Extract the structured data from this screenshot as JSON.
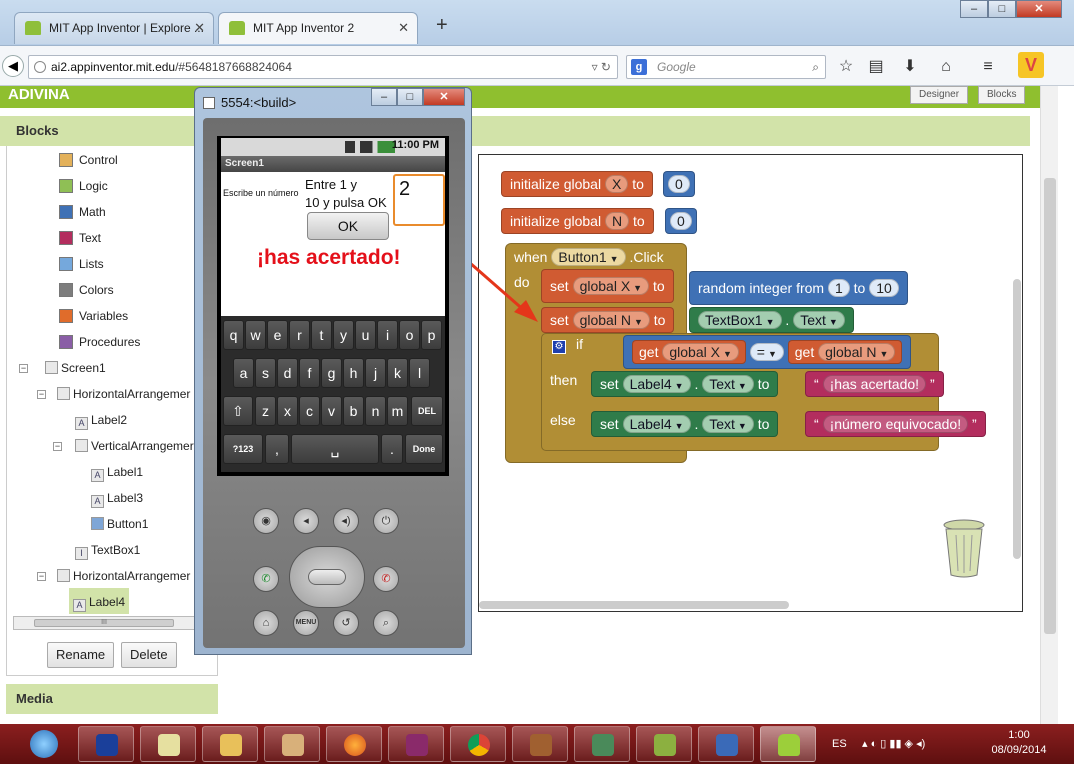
{
  "browser": {
    "tabs": [
      {
        "label": "MIT App Inventor | Explore ..."
      },
      {
        "label": "MIT App Inventor 2"
      }
    ],
    "new_tab": "+",
    "url_domain": "ai2.appinventor.mit.edu",
    "url_path": "/#5648187668824064",
    "search_placeholder": "Google",
    "window_controls": {
      "minimize": "–",
      "maximize": "□",
      "close": "✕"
    }
  },
  "app": {
    "project_name": "ADIVINA",
    "designer_button": "Designer",
    "blocks_button": "Blocks"
  },
  "sidebar": {
    "header": "Blocks",
    "builtin": [
      {
        "label": "Control",
        "color": "#e3b15a"
      },
      {
        "label": "Logic",
        "color": "#8fbf55"
      },
      {
        "label": "Math",
        "color": "#3f71b5"
      },
      {
        "label": "Text",
        "color": "#b32d5e"
      },
      {
        "label": "Lists",
        "color": "#75a8dc"
      },
      {
        "label": "Colors",
        "color": "#7d7d7d"
      },
      {
        "label": "Variables",
        "color": "#e06c2b"
      },
      {
        "label": "Procedures",
        "color": "#8a5ea6"
      }
    ],
    "tree": [
      {
        "label": "Screen1"
      },
      {
        "label": "HorizontalArrangemer"
      },
      {
        "label": "Label2"
      },
      {
        "label": "VerticalArrangemer"
      },
      {
        "label": "Label1"
      },
      {
        "label": "Label3"
      },
      {
        "label": "Button1"
      },
      {
        "label": "TextBox1"
      },
      {
        "label": "HorizontalArrangemer"
      },
      {
        "label": "Label4"
      }
    ],
    "scroll_thumb": "III",
    "rename_button": "Rename",
    "delete_button": "Delete",
    "media_header": "Media"
  },
  "workspace": {
    "init_x": {
      "keyword": "initialize global",
      "name": "X",
      "to": "to",
      "value": "0"
    },
    "init_n": {
      "keyword": "initialize global",
      "name": "N",
      "to": "to",
      "value": "0"
    },
    "event": {
      "when": "when",
      "component": "Button1",
      "event": ".Click",
      "do": "do"
    },
    "set_x": {
      "set": "set",
      "var": "global X",
      "to": "to",
      "func": "random integer",
      "from": "from",
      "min": "1",
      "to2": "to",
      "max": "10"
    },
    "set_n": {
      "set": "set",
      "var": "global N",
      "to": "to",
      "component": "TextBox1",
      "dot": ".",
      "prop": "Text"
    },
    "if_block": {
      "if": "if",
      "get": "get",
      "left": "global X",
      "op": "=",
      "get2": "get",
      "right": "global N"
    },
    "then_block": {
      "then": "then",
      "set": "set",
      "component": "Label4",
      "dot": ".",
      "prop": "Text",
      "to": "to",
      "text": "¡has acertado!"
    },
    "else_block": {
      "else": "else",
      "set": "set",
      "component": "Label4",
      "dot": ".",
      "prop": "Text",
      "to": "to",
      "text": "¡número equivocado!"
    },
    "quote_open": "“",
    "quote_close": "”"
  },
  "emulator": {
    "title": "5554:<build>",
    "status_time": "11:00 PM",
    "screen_title": "Screen1",
    "label2": "Escribe un número",
    "label1_line1": "Entre 1 y",
    "label1_line2": "10 y pulsa OK",
    "textbox_value": "2",
    "ok_button": "OK",
    "result_label": "¡has acertado!",
    "keys_row1": [
      "q",
      "w",
      "e",
      "r",
      "t",
      "y",
      "u",
      "i",
      "o",
      "p"
    ],
    "keys_row2": [
      "a",
      "s",
      "d",
      "f",
      "g",
      "h",
      "j",
      "k",
      "l"
    ],
    "keys_row3": [
      "z",
      "x",
      "c",
      "v",
      "b",
      "n",
      "m"
    ],
    "key_shift": "⇧",
    "key_del": "DEL",
    "key_123": "?123",
    "key_comma": ",",
    "key_space": "␣",
    "key_period": ".",
    "key_done": "Done",
    "hw_menu": "MENU"
  },
  "taskbar": {
    "language": "ES",
    "time": "1:00",
    "date": "08/09/2014"
  }
}
